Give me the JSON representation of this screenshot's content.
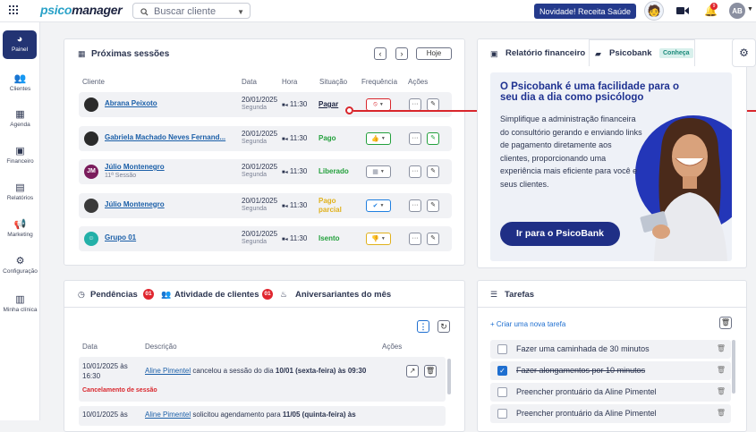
{
  "topbar": {
    "logo_a": "psico",
    "logo_b": "manager",
    "search_placeholder": "Buscar cliente",
    "novidade": "Novidade! Receita Saúde",
    "bell_count": "9",
    "avatar": "AB"
  },
  "sidebar": [
    {
      "label": "Painel",
      "icon": "gauge-icon"
    },
    {
      "label": "Clientes",
      "icon": "users-icon"
    },
    {
      "label": "Agenda",
      "icon": "calendar-icon"
    },
    {
      "label": "Financeiro",
      "icon": "money-icon"
    },
    {
      "label": "Relatórios",
      "icon": "document-icon"
    },
    {
      "label": "Marketing",
      "icon": "megaphone-icon"
    },
    {
      "label": "Configuração",
      "icon": "gear-icon"
    },
    {
      "label": "Minha clínica",
      "icon": "building-icon"
    }
  ],
  "sessions": {
    "title": "Próximas sessões",
    "today": "Hoje",
    "headers": [
      "Cliente",
      "Data",
      "Hora",
      "Situação",
      "Frequência",
      "Ações"
    ],
    "rows": [
      {
        "name": "Abrana Peixoto",
        "sub": "",
        "date": "20/01/2025",
        "day": "Segunda",
        "time": "11:30",
        "status": "Pagar",
        "status_color": "#1c2340",
        "freq_color": "#d9262c",
        "freq_icon": "⦸"
      },
      {
        "name": "Gabriela Machado Neves Fernand...",
        "sub": "",
        "date": "20/01/2025",
        "day": "Segunda",
        "time": "11:30",
        "status": "Pago",
        "status_color": "#23a03c",
        "freq_color": "#23a03c",
        "freq_icon": "👍"
      },
      {
        "name": "Júlio Montenegro",
        "sub": "11ª Sessão",
        "date": "20/01/2025",
        "day": "Segunda",
        "time": "11:30",
        "status": "Liberado",
        "status_color": "#23a03c",
        "freq_color": "#8a90a0",
        "freq_icon": "▦"
      },
      {
        "name": "Júlio Montenegro",
        "sub": "",
        "date": "20/01/2025",
        "day": "Segunda",
        "time": "11:30",
        "status": "Pago parcial",
        "status_color": "#e0b11c",
        "freq_color": "#1f7fe0",
        "freq_icon": "✔"
      },
      {
        "name": "Grupo 01",
        "sub": "",
        "date": "20/01/2025",
        "day": "Segunda",
        "time": "11:30",
        "status": "Isento",
        "status_color": "#23a03c",
        "freq_color": "#e0b11c",
        "freq_icon": "👎"
      }
    ]
  },
  "finance": {
    "tab1": "Relatório financeiro",
    "tab2": "Psicobank",
    "badge": "Conheça",
    "headline": "O Psicobank é uma facilidade para o seu dia a dia como psicólogo",
    "body": "Simplifique a administração financeira do consultório gerando e enviando links de pagamento diretamente aos clientes, proporcionando uma experiência mais eficiente para você e seus clientes.",
    "cta": "Ir para o PsicoBank"
  },
  "pend": {
    "tab1": "Pendências",
    "tab1_count": "01",
    "tab2": "Atividade de clientes",
    "tab2_count": "01",
    "tab3": "Aniversariantes do mês",
    "h_data": "Data",
    "h_desc": "Descrição",
    "h_acoes": "Ações",
    "r1_date": "10/01/2025 às 16:30",
    "r1_link": "Aline Pimentel",
    "r1_text": " cancelou a sessão do dia ",
    "r1_bold": "10/01 (sexta-feira) às 09:30",
    "r1_tag": "Cancelamento de sessão",
    "r2_date": "10/01/2025 às",
    "r2_link": "Aline Pimentel",
    "r2_text": " solicitou agendamento para ",
    "r2_bold": "11/05 (quinta-feira) às"
  },
  "tasks": {
    "title": "Tarefas",
    "new": "Criar uma nova tarefa",
    "items": [
      {
        "text": "Fazer uma caminhada de 30 minutos",
        "done": false
      },
      {
        "text": "Fazer alongamentos por 10 minutos",
        "done": true
      },
      {
        "text": "Preencher prontuário da Aline Pimentel",
        "done": false
      },
      {
        "text": "Preencher prontuário da Aline Pimentel",
        "done": false
      }
    ]
  }
}
